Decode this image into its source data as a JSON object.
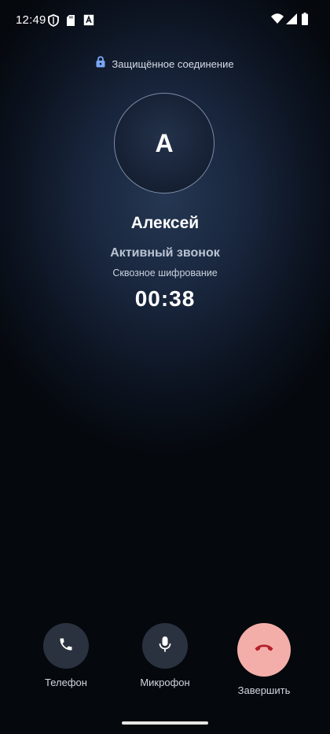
{
  "status_bar": {
    "time": "12:49",
    "icons": [
      "shield-icon",
      "sd-card-icon",
      "a-box-icon",
      "wifi-icon",
      "signal-icon",
      "battery-icon"
    ]
  },
  "secure": {
    "icon": "lock-icon",
    "text": "Защищённое соединение",
    "icon_color": "#7aa7f5"
  },
  "contact": {
    "initial": "А",
    "name": "Алексей"
  },
  "call": {
    "status": "Активный звонок",
    "encryption": "Сквозное шифрование",
    "timer": "00:38"
  },
  "controls": {
    "phone_label": "Телефон",
    "mic_label": "Микрофон",
    "end_label": "Завершить",
    "end_color": "#f4aea9",
    "end_icon_color": "#b3202a"
  }
}
